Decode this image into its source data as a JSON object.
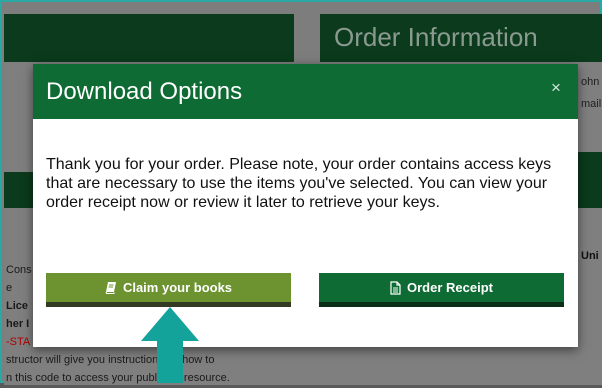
{
  "background": {
    "order_panel_title": "Order Information",
    "right_fragments": [
      "ohn",
      "mail"
    ],
    "right_bold_fragment": "Uni",
    "left_fragments": [
      {
        "text": "Cons",
        "style": ""
      },
      {
        "text": "e",
        "style": ""
      },
      {
        "text": "Lice",
        "style": "bold"
      },
      {
        "text": "her I",
        "style": "bold"
      },
      {
        "text": "-STA",
        "style": "red"
      },
      {
        "text": "structor will give you instructions on how to",
        "style": ""
      },
      {
        "text": "n this code to access your publisher resource.",
        "style": ""
      }
    ]
  },
  "modal": {
    "title": "Download Options",
    "close_label": "×",
    "message": "Thank you for your order. Please note, your order contains access keys that are necessary to use the items you've selected. You can view your order receipt now or review it later to retrieve your keys.",
    "buttons": {
      "claim_label": "Claim your books",
      "claim_icon": "book-icon",
      "receipt_label": "Order Receipt",
      "receipt_icon": "document-icon"
    }
  },
  "annotation": {
    "arrow_color": "#14a39a",
    "arrow_icon": "up-arrow-icon"
  },
  "colors": {
    "header_green": "#0e6b33",
    "claim_green": "#6c9330",
    "frame_teal": "#2aa9a4"
  }
}
